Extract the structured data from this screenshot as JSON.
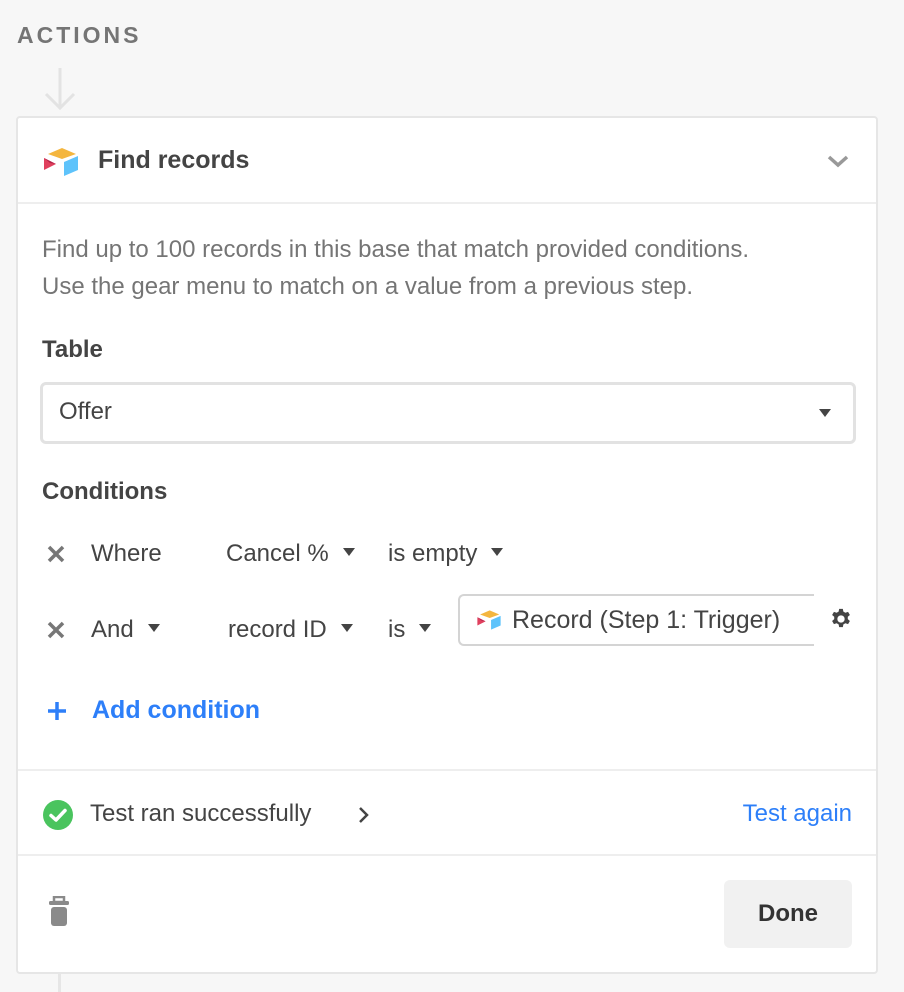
{
  "section": {
    "label": "ACTIONS"
  },
  "action": {
    "title": "Find records",
    "icon": "airtable-logo-icon",
    "description_lines": [
      "Find up to 100 records in this base that match provided conditions.",
      "Use the gear menu to match on a value from a previous step."
    ]
  },
  "table_field": {
    "label": "Table",
    "selected": "Offer"
  },
  "conditions": {
    "label": "Conditions",
    "rows": [
      {
        "conjunction": "Where",
        "field": "Cancel %",
        "operator": "is empty",
        "value": null
      },
      {
        "conjunction": "And",
        "field": "record ID",
        "operator": "is",
        "value": "Record (Step 1: Trigger)"
      }
    ],
    "add_label": "Add condition"
  },
  "test": {
    "status": "Test ran successfully",
    "again_label": "Test again",
    "status_color": "#4ac45e"
  },
  "footer": {
    "done_label": "Done"
  },
  "colors": {
    "accent": "#2d7ff9",
    "logo_yellow": "#fcb400",
    "logo_red": "#e0405e",
    "logo_blue": "#2ea4f4"
  }
}
